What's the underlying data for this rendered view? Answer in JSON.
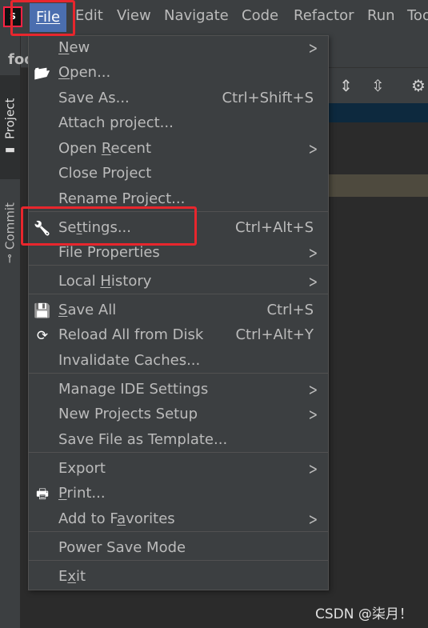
{
  "menubar": {
    "logo_text": "S",
    "items": [
      {
        "label": "File",
        "mnemonic_index": 0
      },
      {
        "label": "Edit",
        "mnemonic_index": 0
      },
      {
        "label": "View",
        "mnemonic_index": 0
      },
      {
        "label": "Navigate",
        "mnemonic_index": 0
      },
      {
        "label": "Code",
        "mnemonic_index": 0
      },
      {
        "label": "Refactor",
        "mnemonic_index": 0
      },
      {
        "label": "Run",
        "mnemonic_index": 1
      },
      {
        "label": "Too",
        "mnemonic_index": 0
      }
    ]
  },
  "sidebar": {
    "tabs": [
      {
        "label": "Project",
        "icon": "folder-icon"
      },
      {
        "label": "Commit",
        "icon": "commit-icon"
      }
    ]
  },
  "editor": {
    "project_title": "foo"
  },
  "file_menu": {
    "items": [
      {
        "label": "New",
        "mn": "N",
        "shortcut": "",
        "submenu": true,
        "icon": ""
      },
      {
        "label": "Open...",
        "mn": "O",
        "shortcut": "",
        "submenu": false,
        "icon": "open-folder-icon"
      },
      {
        "label": "Save As...",
        "mn": "",
        "shortcut": "Ctrl+Shift+S",
        "submenu": false,
        "icon": ""
      },
      {
        "label": "Attach project...",
        "mn": "",
        "shortcut": "",
        "submenu": false,
        "icon": ""
      },
      {
        "label": "Open Recent",
        "mn": "R",
        "shortcut": "",
        "submenu": true,
        "icon": ""
      },
      {
        "label": "Close Project",
        "mn": "",
        "shortcut": "",
        "submenu": false,
        "icon": ""
      },
      {
        "label": "Rename Project...",
        "mn": "",
        "shortcut": "",
        "submenu": false,
        "icon": ""
      },
      {
        "label": "Settings...",
        "mn": "t",
        "shortcut": "Ctrl+Alt+S",
        "submenu": false,
        "icon": "wrench-icon"
      },
      {
        "label": "File Properties",
        "mn": "",
        "shortcut": "",
        "submenu": true,
        "icon": ""
      },
      {
        "label": "Local History",
        "mn": "H",
        "shortcut": "",
        "submenu": true,
        "icon": ""
      },
      {
        "label": "Save All",
        "mn": "S",
        "shortcut": "Ctrl+S",
        "submenu": false,
        "icon": "save-icon"
      },
      {
        "label": "Reload All from Disk",
        "mn": "",
        "shortcut": "Ctrl+Alt+Y",
        "submenu": false,
        "icon": "reload-icon"
      },
      {
        "label": "Invalidate Caches...",
        "mn": "",
        "shortcut": "",
        "submenu": false,
        "icon": ""
      },
      {
        "label": "Manage IDE Settings",
        "mn": "",
        "shortcut": "",
        "submenu": true,
        "icon": ""
      },
      {
        "label": "New Projects Setup",
        "mn": "",
        "shortcut": "",
        "submenu": true,
        "icon": ""
      },
      {
        "label": "Save File as Template...",
        "mn": "",
        "shortcut": "",
        "submenu": false,
        "icon": ""
      },
      {
        "label": "Export",
        "mn": "",
        "shortcut": "",
        "submenu": true,
        "icon": ""
      },
      {
        "label": "Print...",
        "mn": "P",
        "shortcut": "",
        "submenu": false,
        "icon": "print-icon"
      },
      {
        "label": "Add to Favorites",
        "mn": "a",
        "shortcut": "",
        "submenu": true,
        "icon": ""
      },
      {
        "label": "Power Save Mode",
        "mn": "",
        "shortcut": "",
        "submenu": false,
        "icon": ""
      },
      {
        "label": "Exit",
        "mn": "x",
        "shortcut": "",
        "submenu": false,
        "icon": ""
      }
    ]
  },
  "watermark": "CSDN @柒月！",
  "colors": {
    "highlight": "#e8262d",
    "menu_active": "#4b6eaf",
    "menu_bg": "#3c3f41"
  }
}
